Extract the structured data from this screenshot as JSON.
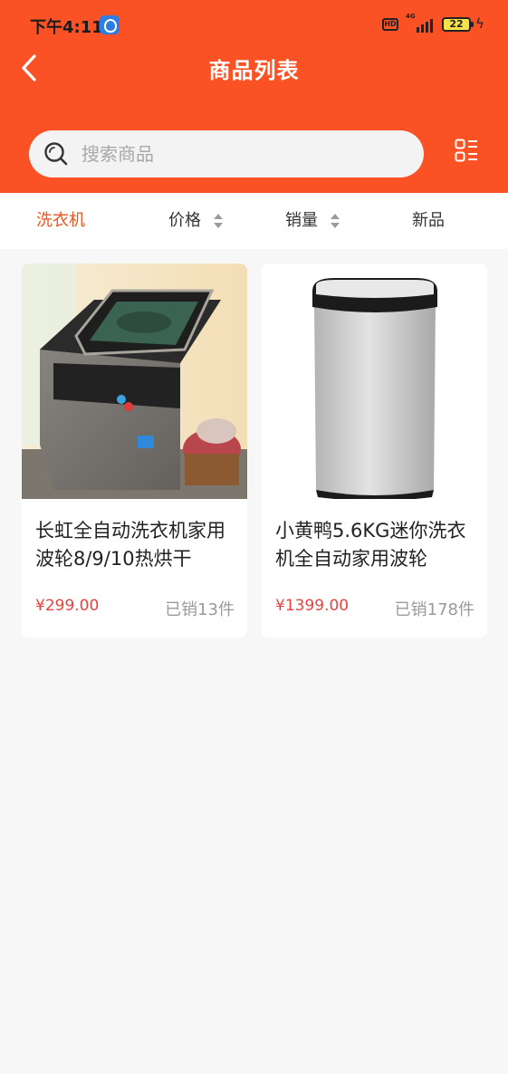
{
  "status_bar": {
    "time": "下午4:11",
    "hd_label": "HD",
    "network": "4G",
    "battery": "22"
  },
  "header": {
    "title": "商品列表"
  },
  "search": {
    "placeholder": "搜索商品",
    "value": ""
  },
  "filters": {
    "tabs": [
      {
        "label": "洗衣机",
        "active": true
      },
      {
        "label": "价格",
        "sortable": true
      },
      {
        "label": "销量",
        "sortable": true
      },
      {
        "label": "新品"
      }
    ]
  },
  "products": [
    {
      "title": "长虹全自动洗衣机家用波轮8/9/10热烘干",
      "price": "¥299.00",
      "sold": "已销13件",
      "image": "top-loader-washing-machine-grey"
    },
    {
      "title": "小黄鸭5.6KG迷你洗衣机全自动家用波轮",
      "price": "¥1399.00",
      "sold": "已销178件",
      "image": "mini-washing-machine-silver"
    }
  ],
  "colors": {
    "header_bg": "#fb5225",
    "active_tab": "#f0541f",
    "price": "#e64340",
    "muted_text": "#9a9a9a",
    "page_bg": "#f7f7f7"
  }
}
